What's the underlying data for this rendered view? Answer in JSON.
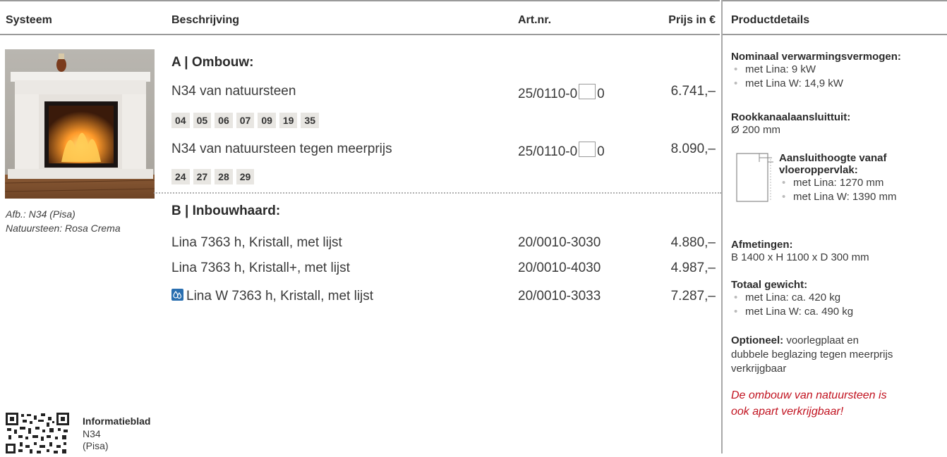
{
  "header": {
    "col_system": "Systeem",
    "col_description": "Beschrijving",
    "col_artnr": "Art.nr.",
    "col_price": "Prijs in €",
    "col_details": "Productdetails"
  },
  "image": {
    "caption_line1": "Afb.: N34 (Pisa)",
    "caption_line2": "Natuursteen: Rosa Crema"
  },
  "section_a": {
    "title": "A | Ombouw:",
    "row1": {
      "label": "N34 van natuursteen",
      "art_prefix": "25/0110-0",
      "art_suffix": "0",
      "price": "6.741,–"
    },
    "codes1": [
      "04",
      "05",
      "06",
      "07",
      "09",
      "19",
      "35"
    ],
    "row2": {
      "label": "N34 van natuursteen tegen meerprijs",
      "art_prefix": "25/0110-0",
      "art_suffix": "0",
      "price": "8.090,–"
    },
    "codes2": [
      "24",
      "27",
      "28",
      "29"
    ]
  },
  "section_b": {
    "title": "B | Inbouwhaard:",
    "rows": [
      {
        "label": "Lina 7363 h, Kristall, met lijst",
        "artnr": "20/0010-3030",
        "price": "4.880,–"
      },
      {
        "label": "Lina 7363 h, Kristall+, met lijst",
        "artnr": "20/0010-4030",
        "price": "4.987,–"
      },
      {
        "label": "Lina W 7363 h, Kristall, met lijst",
        "artnr": "20/0010-3033",
        "price": "7.287,–",
        "icon": "water-heating-icon"
      }
    ]
  },
  "details": {
    "power_title": "Nominaal verwarmingsvermogen:",
    "power_items": [
      "met Lina: 9 kW",
      "met Lina W: 14,9 kW"
    ],
    "flue_title": "Rookkanaalaansluittuit:",
    "flue_value": "Ø 200 mm",
    "height_title_1": "Aansluithoogte vanaf",
    "height_title_2": "vloeroppervlak:",
    "height_items": [
      "met Lina: 1270 mm",
      "met Lina W: 1390 mm"
    ],
    "dims_title": "Afmetingen:",
    "dims_value": "B 1400 x H 1100 x D 300 mm",
    "weight_title": "Totaal gewicht:",
    "weight_items": [
      "met Lina: ca. 420 kg",
      "met Lina W: ca. 490 kg"
    ],
    "optional_label": "Optioneel:",
    "optional_text_1": "voorlegplaat en",
    "optional_text_2": "dubbele beglazing tegen meerprijs",
    "optional_text_3": "verkrijgbaar",
    "note_1": "De ombouw van natuursteen is",
    "note_2": "ook apart verkrijgbaar!"
  },
  "info": {
    "title": "Informatieblad",
    "line1": "N34",
    "line2": "(Pisa)"
  },
  "colors": {
    "accent_red": "#c1121f",
    "water_blue": "#2a6fb0",
    "code_bg": "#e8e6e2"
  }
}
